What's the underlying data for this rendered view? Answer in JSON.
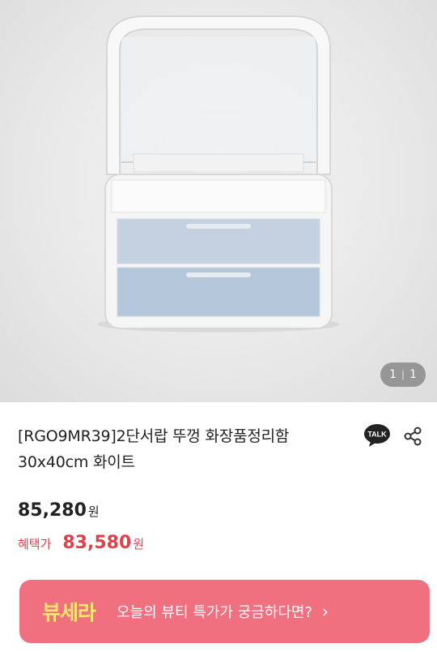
{
  "gallery": {
    "current": "1",
    "separator": "|",
    "total": "1"
  },
  "product": {
    "title_line1": "[RGO9MR39]2단서랍 뚜껑 화장품정리함",
    "title_line2": "30x40cm 화이트",
    "price": "85,280",
    "currency": "원",
    "benefit_label": "혜택가",
    "benefit_price": "83,580",
    "benefit_currency": "원"
  },
  "actions": {
    "talk_label": "TALK"
  },
  "banner": {
    "logo": "뷰세라",
    "text": "오늘의 뷰티 특가가 궁금하다면?",
    "chevron": "›"
  },
  "colors": {
    "accent": "#e0404a",
    "banner_bg": "#f0707f",
    "logo": "#fde66e"
  }
}
